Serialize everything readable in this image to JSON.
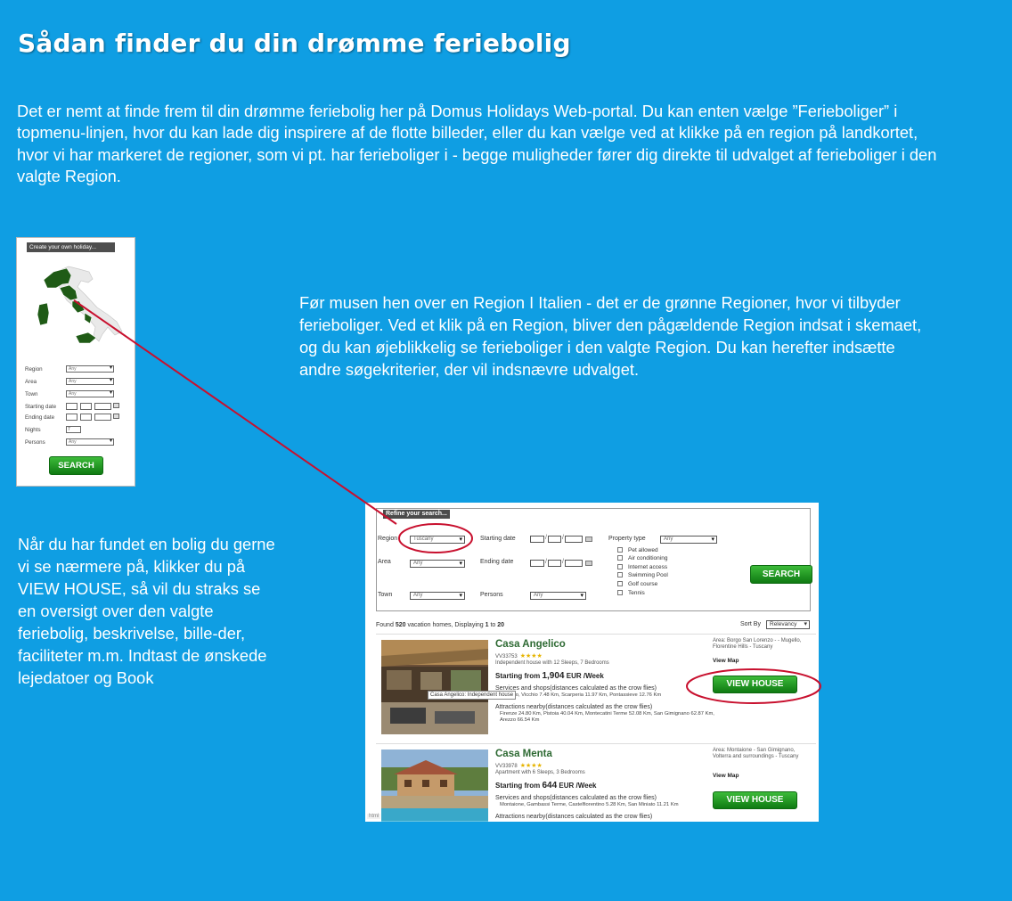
{
  "colors": {
    "background": "#0f9ee3",
    "button_green": "#1f9a24",
    "annotation_red": "#c8102e",
    "map_green": "#1f5b16"
  },
  "title": "Sådan finder du din drømme feriebolig",
  "intro": "Det er nemt at finde frem til din drømme feriebolig her på Domus Holidays Web-portal. Du kan enten vælge ”Ferieboliger” i topmenu-linjen, hvor du kan lade dig inspirere af de flotte billeder, eller du kan vælge ved at klikke på en region på landkortet, hvor vi har markeret de regioner, som vi pt. har ferieboliger i - begge muligheder fører dig direkte til udvalget af ferieboliger i den valgte Region.",
  "map_description": "Før musen hen over en Region I Italien - det er de grønne Regioner, hvor vi tilbyder ferieboliger. Ved et klik på en Region, bliver den pågældende Region indsat i skemaet, og du kan øjeblikkelig se ferieboliger i den valgte Region. Du kan herefter indsætte andre søgekriterier, der vil indsnævre udvalget.",
  "result_description": "Når du har fundet en bolig du gerne vi se nærmere på, klikker du på VIEW HOUSE, så vil du straks se en oversigt over den valgte feriebolig, beskrivelse, bille-der, faciliteter m.m. Indtast de ønskede lejedatoer og Book",
  "widget": {
    "heading": "Create your own holiday...",
    "fields": {
      "region": {
        "label": "Region",
        "value": "Any"
      },
      "area": {
        "label": "Area",
        "value": "Any"
      },
      "town": {
        "label": "Town",
        "value": "Any"
      },
      "starting_date": {
        "label": "Starting date"
      },
      "ending_date": {
        "label": "Ending date"
      },
      "nights": {
        "label": "Nights",
        "value": "7"
      },
      "persons": {
        "label": "Persons",
        "value": "Any"
      }
    },
    "search_label": "SEARCH"
  },
  "search_page": {
    "refine_heading": "Refine your search...",
    "fields": {
      "region": {
        "label": "Region",
        "value": "Tuscany"
      },
      "area": {
        "label": "Area",
        "value": "Any"
      },
      "town": {
        "label": "Town",
        "value": "Any"
      },
      "starting_date": {
        "label": "Starting date"
      },
      "ending_date": {
        "label": "Ending date"
      },
      "persons": {
        "label": "Persons",
        "value": "Any"
      },
      "property_type": {
        "label": "Property type",
        "value": "Any"
      }
    },
    "amenities": [
      "Pet allowed",
      "Air conditioning",
      "Internet access",
      "Swimming Pool",
      "Golf course",
      "Tennis"
    ],
    "search_label": "SEARCH",
    "found": {
      "prefix": "Found",
      "count": "520",
      "middle": "vacation homes, Displaying",
      "from": "1",
      "to_word": "to",
      "to": "20"
    },
    "sort": {
      "label": "Sort By",
      "value": "Relevancy"
    },
    "listings": [
      {
        "name": "Casa Angelico",
        "code": "VV33753",
        "stars": "★★★★",
        "description": "Independent house with 12 Sleeps, 7 Bedrooms",
        "price_prefix": "Starting from",
        "price": "1,904",
        "price_suffix": "EUR /Week",
        "services_heading": "Services and shops(distances calculated as the crow flies)",
        "services": "Lorenzo, Vicchio 7.48 Km, Scarperia 11.97 Km, Pontassieve 12.76 Km",
        "attractions_heading": "Attractions nearby(distances calculated as the crow flies)",
        "attractions": "Firenze 24.80 Km, Pistoia 40.04 Km, Montecatini Terme 52.08 Km, San Gimignano 62.87 Km, Arezzo 66.54 Km",
        "area": "Area: Borgo San Lorenzo - - Mugello, Florentine Hills - Tuscany",
        "map_link": "View Map",
        "button": "VIEW HOUSE",
        "tooltip": "Casa Angelico: Independent house"
      },
      {
        "name": "Casa Menta",
        "code": "VV33978",
        "stars": "★★★★",
        "description": "Apartment with 6 Sleeps, 3 Bedrooms",
        "price_prefix": "Starting from",
        "price": "644",
        "price_suffix": "EUR /Week",
        "services_heading": "Services and shops(distances calculated as the crow flies)",
        "services": "Montaione, Gambassi Terme, Castelfiorentino 5.28 Km, San Miniato 11.21 Km",
        "attractions_heading": "Attractions nearby(distances calculated as the crow flies)",
        "area": "Area: Montaione - San Gimignano, Volterra and surroundings - Tuscany",
        "map_link": "View Map",
        "button": "VIEW HOUSE"
      }
    ],
    "status_tag": "html"
  }
}
